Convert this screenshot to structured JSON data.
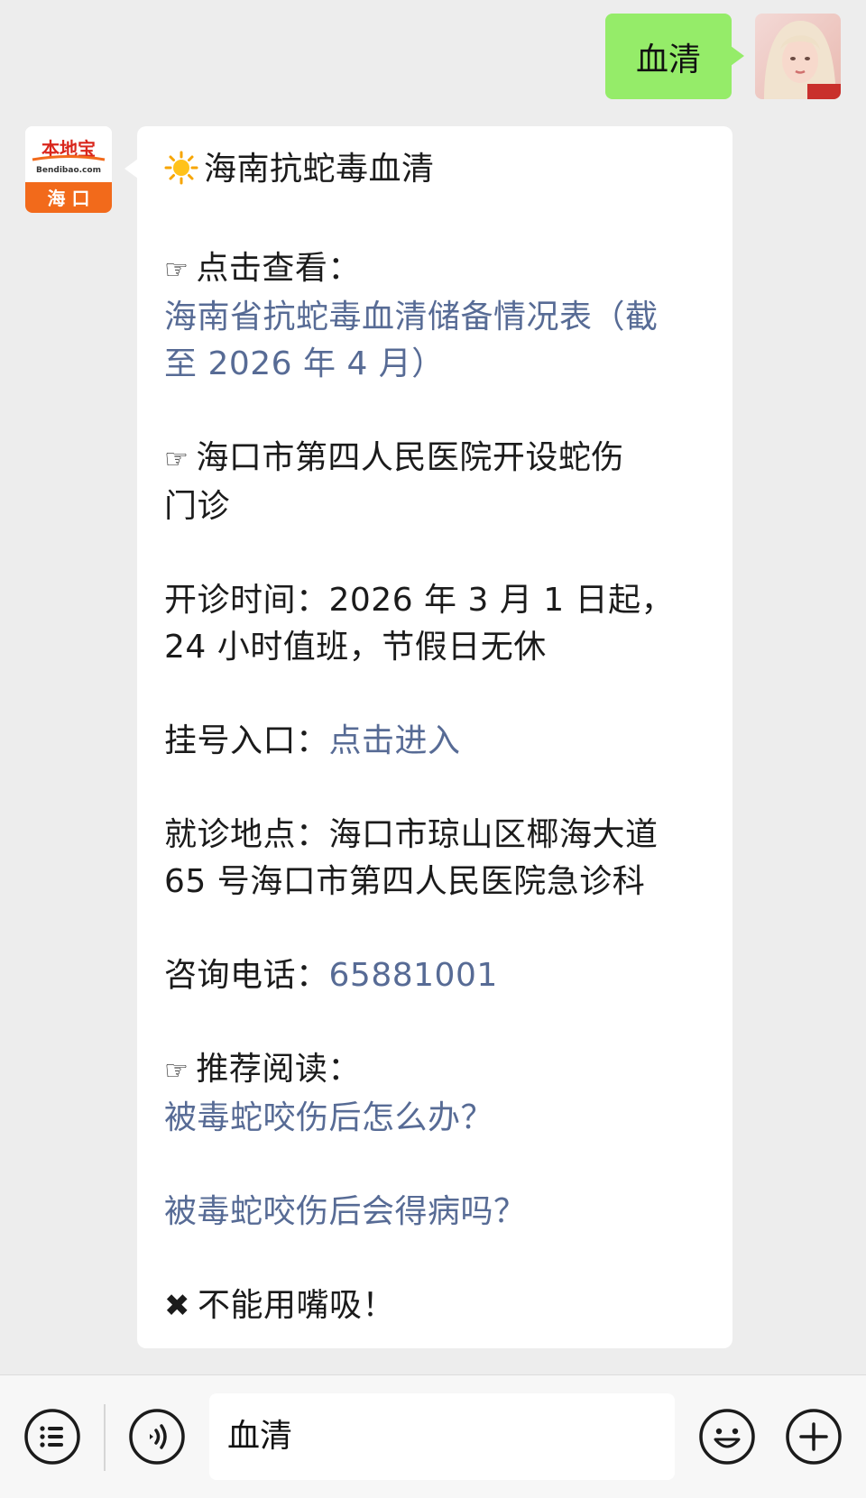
{
  "outgoing_message": {
    "text": "血清"
  },
  "incoming_message": {
    "sender_logo": {
      "brand": "本地宝",
      "site": "Bendibao.com",
      "city": "海口"
    },
    "title": "海南抗蛇毒血清",
    "click_view_label": "点击查看：",
    "reserve_link_line1": "海南省抗蛇毒血清储备情况表（截",
    "reserve_link_line2": "至 2026 年 4 月）",
    "clinic_line1": "海口市第四人民医院开设蛇伤",
    "clinic_line2": "门诊",
    "hours_line1": "开诊时间：2026 年 3 月 1 日起，",
    "hours_line2": "24 小时值班，节假日无休",
    "registration_label": "挂号入口：",
    "registration_link": "点击进入",
    "address_line1": "就诊地点：海口市琼山区椰海大道",
    "address_line2": "65 号海口市第四人民医院急诊科",
    "phone_label": "咨询电话：",
    "phone_number": "65881001",
    "recommend_label": "推荐阅读：",
    "recommend_link1": "被毒蛇咬伤后怎么办？",
    "recommend_link2": "被毒蛇咬伤后会得病吗？",
    "warning": "不能用嘴吸！"
  },
  "input_bar": {
    "value": "血清"
  },
  "colors": {
    "outgoing_bubble": "#95ec69",
    "link": "#576b95",
    "background": "#ededed",
    "logo_orange": "#f26a1b"
  },
  "icons": [
    "menu-list-icon",
    "voice-icon",
    "emoji-icon",
    "plus-icon",
    "pointing-hand-icon",
    "sun-icon",
    "cross-mark-icon"
  ]
}
